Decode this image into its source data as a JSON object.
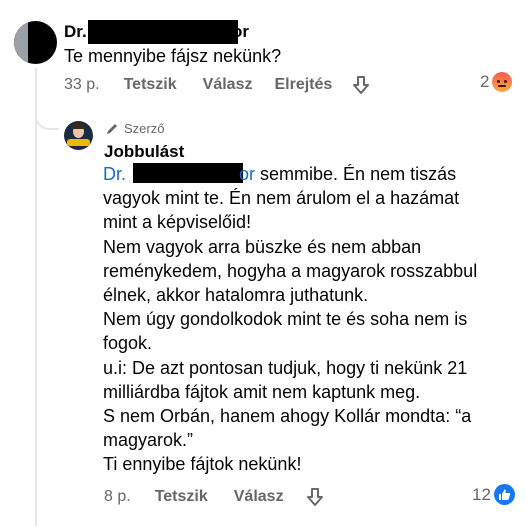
{
  "comment": {
    "author_prefix": "Dr. ",
    "author_suffix": "or",
    "text": "Te mennyibe fájsz nekünk?",
    "time": "33 p.",
    "like_label": "Tetszik",
    "reply_label": "Válasz",
    "hide_label": "Elrejtés",
    "reaction_count": "2",
    "reaction_icon": "angry-reaction-icon"
  },
  "reply": {
    "badge_label": "Szerző",
    "author": "Jobbulást",
    "mention_prefix": "Dr. ",
    "mention_suffix": "or",
    "lines": [
      " semmibe. Én nem tiszás",
      "vagyok mint te. Én nem árulom el a hazámat",
      "mint a képviselőid!",
      "Nem vagyok arra büszke és nem abban",
      "reménykedem, hogyha a magyarok rosszabbul",
      "élnek, akkor hatalomra juthatunk.",
      "Nem úgy gondolkodok mint te és soha nem is",
      "fogok.",
      "u.i: De azt pontosan tudjuk, hogy ti nekünk 21",
      "milliárdba fájtok amit nem kaptunk meg.",
      "S nem Orbán, hanem ahogy Kollár mondta: “a",
      "magyarok.”",
      "Ti ennyibe fájtok nekünk!"
    ],
    "time": "8 p.",
    "like_label": "Tetszik",
    "reply_label": "Válasz",
    "reaction_count": "12",
    "reaction_icon": "like-reaction-icon"
  },
  "colors": {
    "mention": "#1a67c4",
    "secondary_text": "#65676b",
    "like_blue": "#1877f2"
  }
}
